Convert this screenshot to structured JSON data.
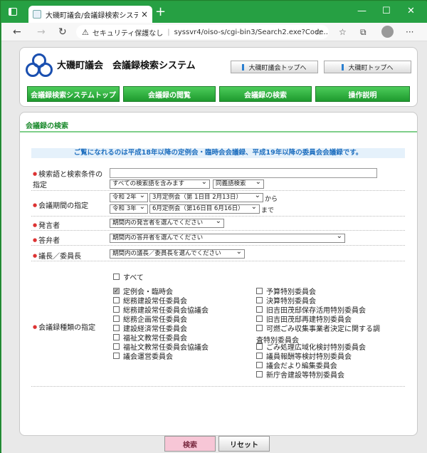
{
  "browser": {
    "tab_title": "大磯町議会/会議録検索システム",
    "tab_close": "×",
    "new_tab": "+",
    "win_min": "—",
    "win_max": "☐",
    "win_close": "✕",
    "back": "←",
    "forward": "→",
    "reload": "↻",
    "security_label": "セキュリティ保護なし",
    "url": "syssvr4/oiso-s/cgi-bin3/Search2.exe?Code...",
    "star": "☆",
    "favorites": "☆",
    "collections": "⧉",
    "more": "···"
  },
  "header": {
    "title": "大磯町議会　会議録検索システム",
    "top_link_council": "大磯町議会トップへ",
    "top_link_town": "大磯町トップへ",
    "menu": [
      "会議録検索システムトップ",
      "会議録の閲覧",
      "会議録の検索",
      "操作説明"
    ]
  },
  "search": {
    "section_title": "会議録の検索",
    "notice": "ご覧になれるのは平成18年以降の定例会・臨時会会議録、平成19年以降の委員会会議録です。",
    "keyword_label_1": "検索語と検索条件の",
    "keyword_label_2": "指定",
    "keyword_value": "",
    "condition_select": "すべての検索語を含みます",
    "synonym_select": "同義語検索",
    "period_label": "会議期間の指定",
    "from_year": "令和 2年",
    "from_session": "3月定例会（第 1日目 2月13日）",
    "from_text": "から",
    "to_year": "令和 3年",
    "to_session": "6月定例会（第16日目 6月16日）",
    "to_text": "まで",
    "speaker_label": "発言者",
    "speaker_select": "期間内の発言者を選んでください",
    "answerer_label": "答弁者",
    "answerer_select": "期間内の答弁者を選んでください",
    "chair_label": "議長／委員長",
    "chair_select": "期間内の議長／委員長を選んでください",
    "type_label": "会議録種類の指定",
    "all_label": "すべて",
    "types_left": [
      {
        "label": "定例会・臨時会",
        "checked": true
      },
      {
        "label": "総務建設常任委員会",
        "checked": false
      },
      {
        "label": "総務建設常任委員会協議会",
        "checked": false
      },
      {
        "label": "総務企画常任委員会",
        "checked": false
      },
      {
        "label": "建設経済常任委員会",
        "checked": false
      },
      {
        "label": "福祉文教常任委員会",
        "checked": false
      },
      {
        "label": "福祉文教常任委員会協議会",
        "checked": false
      },
      {
        "label": "議会運営委員会",
        "checked": false
      }
    ],
    "types_right": [
      {
        "label": "予算特別委員会",
        "checked": false
      },
      {
        "label": "決算特別委員会",
        "checked": false
      },
      {
        "label": "旧吉田茂邸保存活用特別委員会",
        "checked": false
      },
      {
        "label": "旧吉田茂邸再建特別委員会",
        "checked": false
      },
      {
        "label": "可燃ごみ収集事業者決定に関する調",
        "checked": false
      },
      {
        "label": "ごみ処理広域化検討特別委員会",
        "checked": false
      },
      {
        "label": "議員報酬等検討特別委員会",
        "checked": false
      },
      {
        "label": "議会だより編集委員会",
        "checked": false
      },
      {
        "label": "新庁舎建設等特別委員会",
        "checked": false
      }
    ],
    "wrap_text": "査特別委員会",
    "search_button": "検索",
    "reset_button": "リセット"
  },
  "colors": {
    "accent_green": "#2a9b3c",
    "notice_blue": "#1f6fbf",
    "search_button_bg": "#f7c6d6"
  }
}
